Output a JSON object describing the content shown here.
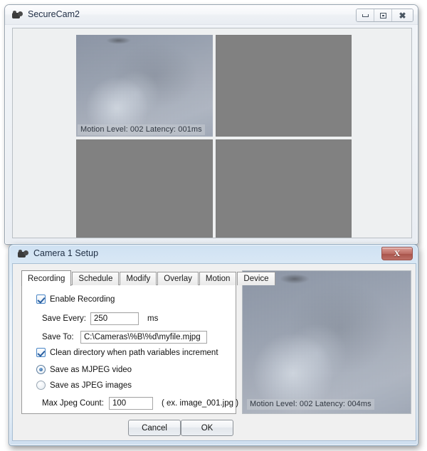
{
  "main_window": {
    "title": "SecureCam2",
    "icon": "camera-icon",
    "window_buttons": {
      "minimize": "minimize-icon",
      "maximize": "maximize-icon",
      "close": "close-icon"
    },
    "video_panels": [
      {
        "id": "panel-1",
        "state": "live",
        "overlay": "Motion Level: 002   Latency: 001ms"
      },
      {
        "id": "panel-2",
        "state": "blank",
        "overlay": ""
      },
      {
        "id": "panel-3",
        "state": "blank",
        "overlay": ""
      },
      {
        "id": "panel-4",
        "state": "blank",
        "overlay": ""
      }
    ]
  },
  "dialog": {
    "title": "Camera 1 Setup",
    "icon": "camera-icon",
    "close_label": "X",
    "tabs": [
      {
        "label": "Recording",
        "active": true
      },
      {
        "label": "Schedule",
        "active": false
      },
      {
        "label": "Modify",
        "active": false
      },
      {
        "label": "Overlay",
        "active": false
      },
      {
        "label": "Motion",
        "active": false
      },
      {
        "label": "Device",
        "active": false
      }
    ],
    "recording_tab": {
      "enable_recording": {
        "label": "Enable Recording",
        "checked": true
      },
      "save_every": {
        "label": "Save Every:",
        "value": "250",
        "unit": "ms"
      },
      "save_to": {
        "label": "Save To:",
        "value": "C:\\Cameras\\%B\\%d\\myfile.mjpg"
      },
      "clean_directory": {
        "label": "Clean directory when path variables increment",
        "checked": true
      },
      "save_as_mjpeg": {
        "label": "Save as MJPEG video",
        "selected": true
      },
      "save_as_jpeg": {
        "label": "Save as JPEG images",
        "selected": false
      },
      "max_jpeg_count": {
        "label": "Max Jpeg Count:",
        "value": "100",
        "hint": "( ex. image_001.jpg )"
      }
    },
    "preview": {
      "overlay": "Motion Level: 002   Latency: 004ms"
    },
    "buttons": {
      "cancel": "Cancel",
      "ok": "OK"
    }
  },
  "colors": {
    "accent": "#4a86c6",
    "close_red": "#bb6b62",
    "video_blank": "#818181",
    "dialog_glass": "#dceaf6"
  }
}
